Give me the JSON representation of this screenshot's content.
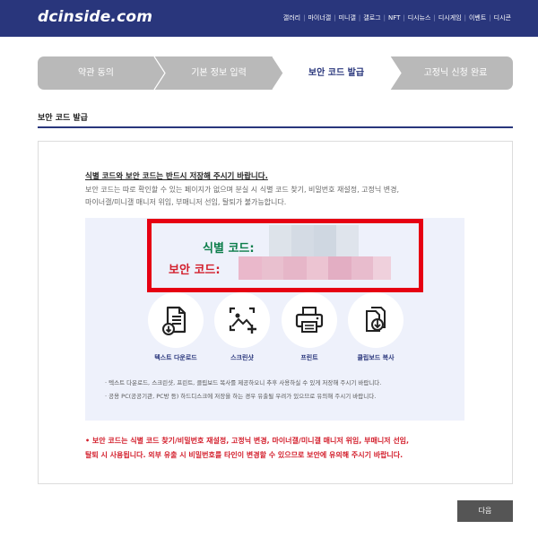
{
  "header": {
    "logo": "dcinside.com",
    "nav": [
      "갤러리",
      "마이너갤",
      "미니갤",
      "갤로그",
      "NFT",
      "디시뉴스",
      "디시게임",
      "이벤트",
      "디시콘"
    ]
  },
  "steps": [
    {
      "label": "약관 동의",
      "state": "done"
    },
    {
      "label": "기본 정보 입력",
      "state": "done"
    },
    {
      "label": "보안 코드 발급",
      "state": "active"
    },
    {
      "label": "고정닉 신청 완료",
      "state": "pending"
    }
  ],
  "section": {
    "title": "보안 코드 발급"
  },
  "notice": {
    "title": "식별 코드와 보안 코드는 반드시 저장해 주시기 바랍니다.",
    "line1": "보안 코드는 따로 확인할 수 있는 페이지가 없으며 분실 시 식별 코드 찾기, 비밀번호 재설정, 고정닉 변경,",
    "line2": "마이너갤/미니갤 매니저 위임, 부매니저 선임, 탈퇴가 불가능합니다."
  },
  "codes": {
    "id_label": "식별 코드:",
    "security_label": "보안 코드:"
  },
  "actions": [
    {
      "label": "텍스트 다운로드",
      "icon": "text-download-icon"
    },
    {
      "label": "스크린샷",
      "icon": "screenshot-icon"
    },
    {
      "label": "프린트",
      "icon": "printer-icon"
    },
    {
      "label": "클립보드 복사",
      "icon": "clipboard-icon"
    }
  ],
  "bullets": [
    "· 텍스트 다운로드, 스크린샷, 프린트, 클립보드 복사를 제공하오니 추후 사용하실 수 있게 저장해 주시기 바랍니다.",
    "· 공용 PC(공공기관, PC방 등) 하드디스크에 저장을 하는 경우 유출될 우려가 있으므로 유의해 주시기 바랍니다."
  ],
  "warning": {
    "line1": "• 보안 코드는 식별 코드 찾기/비밀번호 재설정, 고정닉 변경, 마이너갤/미니갤 매니저 위임, 부매니저 선임,",
    "line2": "탈퇴 시 사용됩니다. 외부 유출 시 비밀번호를 타인이 변경할 수 있으므로 보안에 유의해 주시기 바랍니다."
  },
  "next_label": "다음",
  "colors": {
    "brand": "#29367c",
    "highlight": "#e60012",
    "id_green": "#0c7d4a",
    "security_red": "#d31f2c"
  }
}
